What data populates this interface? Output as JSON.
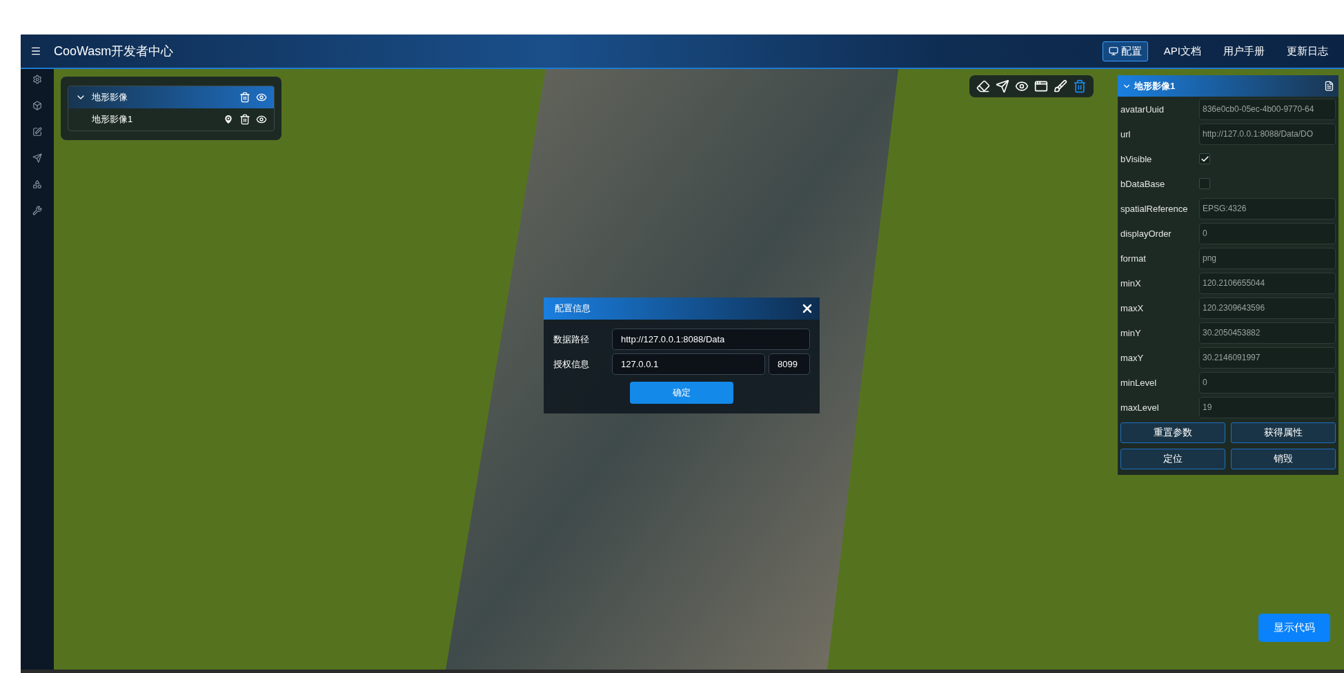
{
  "header": {
    "title": "CooWasm开发者中心",
    "nav": [
      {
        "label": "配置",
        "selected": true
      },
      {
        "label": "API文档",
        "selected": false
      },
      {
        "label": "用户手册",
        "selected": false
      },
      {
        "label": "更新日志",
        "selected": false
      }
    ]
  },
  "layer_tree": {
    "items": [
      {
        "label": "地形影像",
        "expanded": true,
        "selected": true,
        "children": [
          {
            "label": "地形影像1",
            "selected": false
          }
        ]
      }
    ]
  },
  "properties_panel": {
    "title": "地形影像1",
    "expanded": true,
    "fields": [
      {
        "kind": "text",
        "label": "avatarUuid",
        "value": "836e0cb0-05ec-4b00-9770-64"
      },
      {
        "kind": "text",
        "label": "url",
        "value": "http://127.0.0.1:8088/Data/DO"
      },
      {
        "kind": "checkbox",
        "label": "bVisible",
        "checked": true
      },
      {
        "kind": "checkbox",
        "label": "bDataBase",
        "checked": false
      },
      {
        "kind": "text",
        "label": "spatialReference",
        "value": "EPSG:4326"
      },
      {
        "kind": "text",
        "label": "displayOrder",
        "value": "0"
      },
      {
        "kind": "text",
        "label": "format",
        "value": "png"
      },
      {
        "kind": "text",
        "label": "minX",
        "value": "120.2106655044"
      },
      {
        "kind": "text",
        "label": "maxX",
        "value": "120.2309643596"
      },
      {
        "kind": "text",
        "label": "minY",
        "value": "30.2050453882"
      },
      {
        "kind": "text",
        "label": "maxY",
        "value": "30.2146091997"
      },
      {
        "kind": "text",
        "label": "minLevel",
        "value": "0"
      },
      {
        "kind": "text",
        "label": "maxLevel",
        "value": "19"
      }
    ],
    "buttons": [
      "重置参数",
      "获得属性",
      "定位",
      "销毁"
    ]
  },
  "dialog": {
    "title": "配置信息",
    "rows": [
      {
        "label": "数据路径",
        "fields": [
          "http://127.0.0.1:8088/Data"
        ]
      },
      {
        "label": "授权信息",
        "fields": [
          "127.0.0.1",
          "8099"
        ]
      }
    ],
    "confirm": "确定"
  },
  "show_code_button": "显示代码"
}
